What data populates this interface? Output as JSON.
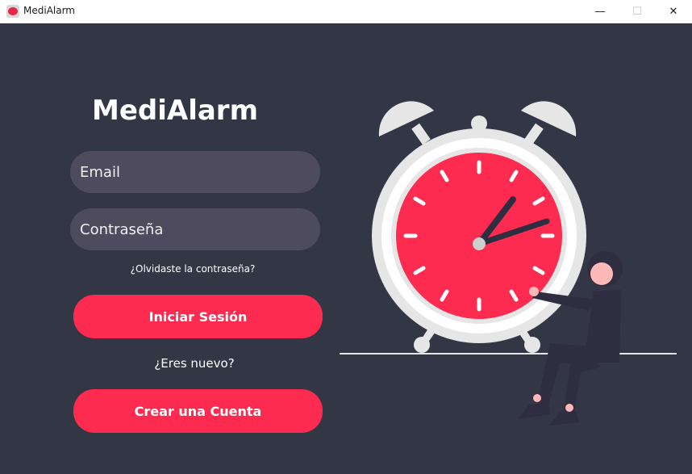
{
  "window": {
    "title": "MediAlarm",
    "minimize_glyph": "—",
    "maximize_glyph": "☐",
    "close_glyph": "✕"
  },
  "login": {
    "brand": "MediAlarm",
    "email_placeholder": "Email",
    "password_placeholder": "Contraseña",
    "forgot_link": "¿Olvidaste la contraseña?",
    "login_button": "Iniciar Sesión",
    "new_user_text": "¿Eres nuevo?",
    "create_account_button": "Crear una Cuenta"
  },
  "illustration": {
    "name": "alarm-clock-with-person",
    "colors": {
      "background": "#333645",
      "clock_face": "#fe2b50",
      "clock_frame": "#e6e6e6",
      "accent": "#fe2b50",
      "figure_dark": "#2f2e41"
    }
  }
}
